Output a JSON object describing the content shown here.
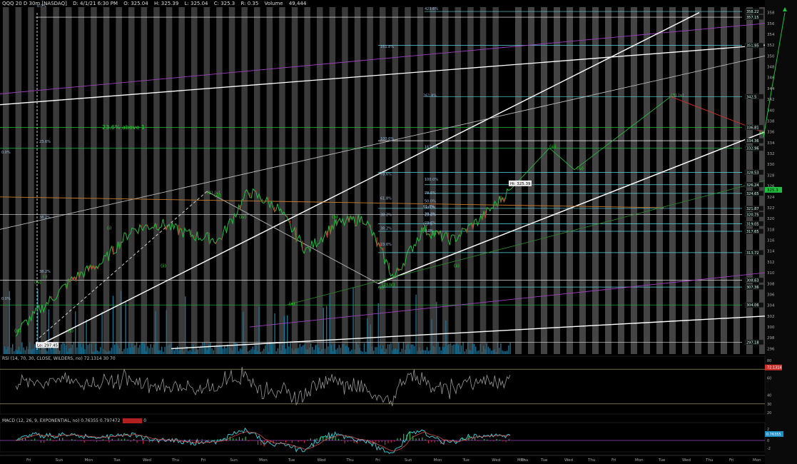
{
  "header": {
    "symbol": "QQQ 20 D 30m [NASDAQ]",
    "date": "D: 4/1/21 6:30 PM",
    "open": "O: 325.04",
    "high": "H: 325.39",
    "low": "L: 325.04",
    "close": "C: 325.3",
    "change": "R: 0.35",
    "volume_label": "Volume",
    "volume": "49,444"
  },
  "rsi_label": "RSI (14, 70, 30, CLOSE, WILDERS, no) 72.1314 30 70",
  "rsi_value": "72.1314",
  "macd_label": "MACD (12, 26, 9, EXPONENTIAL, no) 0.76355 0.797472",
  "macd_value": "0.76355",
  "macd_diff": "0",
  "colors": {
    "up": "#1fbf3f",
    "down": "#d0302a",
    "accent": "#00aaff",
    "green_label": "#22dd22",
    "cyan": "#5ad6e0",
    "magenta": "#a040c0"
  },
  "chart_data": {
    "type": "line",
    "title": "",
    "xlabel": "",
    "ylabel": "",
    "ylim": [
      295,
      359
    ],
    "x": [
      "Fri",
      "Sun",
      "Mon",
      "Tue",
      "Wed",
      "Thu",
      "Fri",
      "Sun",
      "Mon",
      "Tue",
      "Wed",
      "Thu",
      "Fri",
      "Sun",
      "Mon",
      "Tue",
      "Wed",
      "Thu"
    ],
    "series": [
      {
        "values": [
          299,
          304,
          309,
          312,
          318,
          319,
          317,
          316,
          325,
          322,
          314,
          319,
          320,
          309,
          318,
          316,
          320,
          325.3
        ]
      }
    ],
    "future_x_labels": [
      "Mon",
      "Tue",
      "Wed",
      "Thu",
      "Fri",
      "Mon",
      "Tue",
      "Wed",
      "Thu",
      "Fri",
      "Mon"
    ],
    "y_ticks": [
      296,
      298,
      300,
      302,
      304,
      306,
      308,
      310,
      312,
      314,
      316,
      318,
      320,
      322,
      324,
      326,
      328,
      330,
      332,
      334,
      336,
      338,
      340,
      342,
      344,
      346,
      348,
      350,
      352,
      354,
      356,
      358
    ],
    "price_levels": [
      "358.22",
      "357.15",
      "351.95",
      "342.5",
      "336.81",
      "334.36",
      "332.96",
      "328.53",
      "326.24",
      "324.65",
      "321.87",
      "320.75",
      "319.05",
      "317.65",
      "313.72",
      "308.63",
      "307.36",
      "304.06",
      "297.18"
    ],
    "current_price": "325.3",
    "low_label": "Lo: 297.45",
    "high_label": "Hi: 325.39",
    "fib_labels": [
      "423.6%",
      "161.8%",
      "261.8%",
      "100.0%",
      "161.8%",
      "78.6%",
      "100.0%",
      "78.6%",
      "61.8%",
      "50.0%",
      "38.2%",
      "23.6%",
      "0.0%",
      "61.8%",
      "50.0%",
      "38.2%",
      "23.6%",
      "0.0%",
      "23.6%",
      "38.2%",
      "23.6%",
      "38.2%",
      "0.0%",
      "0.0%",
      "0.0%",
      "38.2%"
    ],
    "wave_labels": [
      "(i)",
      "(ii)",
      "(iii)",
      "(iv)",
      "(i)",
      "(ii)",
      "(iii)",
      "(iv)",
      "(a)",
      "(b)",
      "(c)",
      "(ii)",
      "(i)",
      "(iii)",
      "(iv)",
      "(3).(v)",
      "(4)",
      "3.v.(5)",
      "(2).(c)",
      "(1).(v)"
    ],
    "annotation": "23.6% above 1",
    "rsi": {
      "ylim": [
        20,
        80
      ],
      "ticks": [
        80,
        60,
        40,
        30,
        20
      ],
      "levels": [
        30,
        70
      ],
      "last": 72.13
    },
    "macd": {
      "ticks": [
        2,
        0,
        -2
      ],
      "last": 0.76355,
      "signal": 0.797472
    }
  }
}
